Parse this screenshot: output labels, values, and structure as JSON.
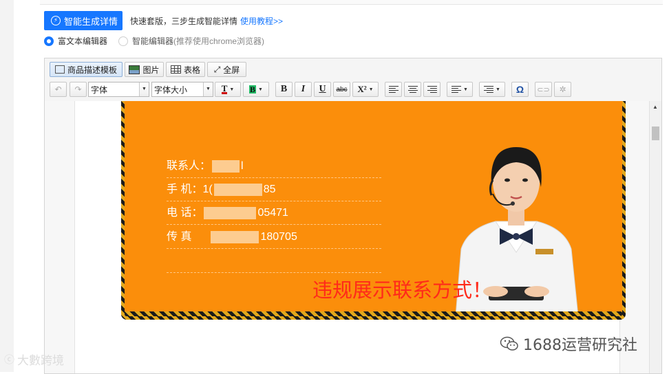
{
  "top": {
    "generate_button": "智能生成详情",
    "quick_text": "快速套版，三步生成智能详情",
    "tutorial_link": "使用教程>>"
  },
  "editor_mode": {
    "rich_text": "富文本编辑器",
    "smart_editor": "智能编辑器",
    "smart_editor_note": "(推荐使用chrome浏览器)",
    "selected": "rich_text"
  },
  "toolbar": {
    "template_button": "商品描述模板",
    "image_button": "图片",
    "table_button": "表格",
    "fullscreen_button": "全屏",
    "font_select": "字体",
    "font_size_select": "字体大小",
    "bold": "B",
    "italic": "I",
    "underline": "U",
    "strike": "abc",
    "superscript": "X²",
    "special_char": "Ω",
    "text_color": "T",
    "bg_color": "B"
  },
  "banner": {
    "background_color": "#fb8e0b",
    "contact_rows": [
      {
        "label": "联系人：",
        "prefix": "",
        "suffix": "l"
      },
      {
        "label": "手  机：",
        "prefix": "1(",
        "suffix": "85"
      },
      {
        "label": "电  话：",
        "prefix": "",
        "suffix": "05471"
      },
      {
        "label": "传  真",
        "prefix": "",
        "suffix": "180705"
      }
    ],
    "warning_text": "违规展示联系方式！",
    "warning_color": "#ff2a1a"
  },
  "watermarks": {
    "left": "大數跨境",
    "right": "1688运营研究社"
  }
}
